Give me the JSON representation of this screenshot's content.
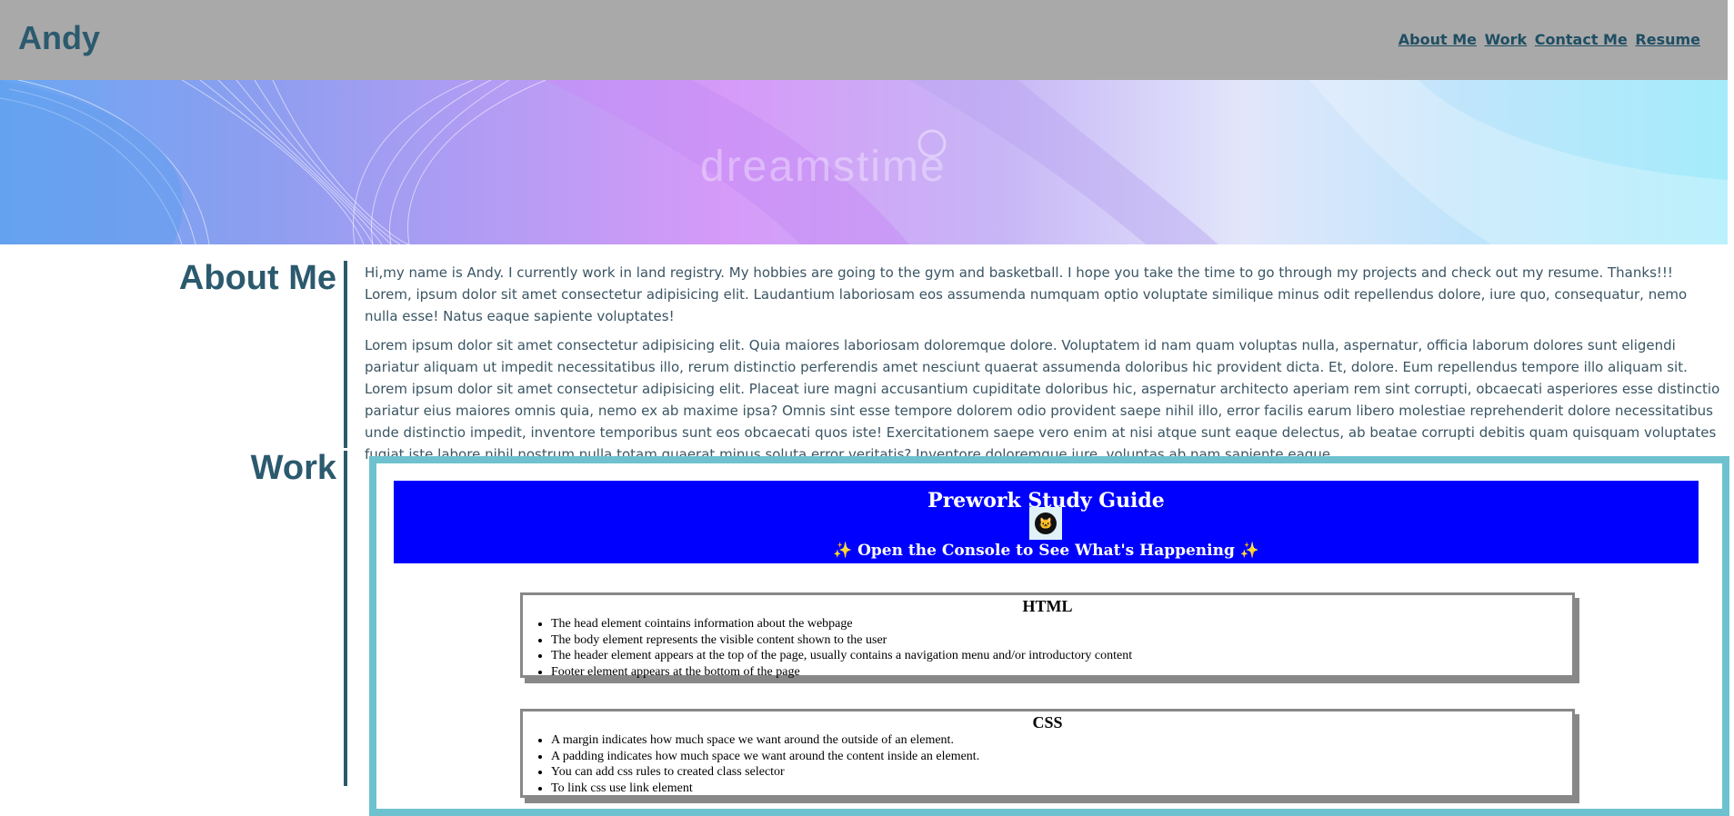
{
  "header": {
    "brand": "Andy",
    "nav": [
      "About Me",
      "Work",
      "Contact Me",
      "Resume"
    ]
  },
  "hero": {
    "watermark": "dreamstime"
  },
  "about": {
    "title": "About Me",
    "paragraphs": [
      "Hi,my name is Andy. I currently work in land registry. My hobbies are going to the gym and basketball. I hope you take the time to go through my projects and check out my resume. Thanks!!! Lorem, ipsum dolor sit amet consectetur adipisicing elit. Laudantium laboriosam eos assumenda numquam optio voluptate similique minus odit repellendus dolore, iure quo, consequatur, nemo nulla esse! Natus eaque sapiente voluptates!",
      "Lorem ipsum dolor sit amet consectetur adipisicing elit. Quia maiores laboriosam doloremque dolore. Voluptatem id nam quam voluptas nulla, aspernatur, officia laborum dolores sunt eligendi pariatur aliquam ut impedit necessitatibus illo, rerum distinctio perferendis amet nesciunt quaerat assumenda doloribus hic provident dicta. Et, dolore. Eum repellendus tempore illo aliquam sit. Lorem ipsum dolor sit amet consectetur adipisicing elit. Placeat iure magni accusantium cupiditate doloribus hic, aspernatur architecto aperiam rem sint corrupti, obcaecati asperiores esse distinctio pariatur eius maiores omnis quia, nemo ex ab maxime ipsa? Omnis sint esse tempore dolorem odio provident saepe nihil illo, error facilis earum libero molestiae reprehenderit dolore necessitatibus unde distinctio impedit, inventore temporibus sunt eos obcaecati quos iste! Exercitationem saepe vero enim at nisi atque sunt eaque delectus, ab beatae corrupti debitis quam quisquam voluptates fugiat iste labore nihil nostrum nulla totam quaerat minus soluta error veritatis? Inventore doloremque iure, voluptas ab nam sapiente eaque."
    ]
  },
  "work": {
    "title": "Work",
    "embed": {
      "title": "Prework Study Guide",
      "subtitle": "✨ Open the Console to See What's Happening ✨",
      "logo_icon": "github-cat-icon",
      "cards": [
        {
          "heading": "HTML",
          "items": [
            "The head element cointains information about the webpage",
            "The body element represents the visible content shown to the user",
            "The header element appears at the top of the page, usually contains a navigation menu and/or introductory content",
            "Footer element appears at the bottom of the page"
          ]
        },
        {
          "heading": "CSS",
          "items": [
            "A margin indicates how much space we want around the outside of an element.",
            "A padding indicates how much space we want around the content inside an element.",
            "You can add css rules to created class selector",
            "To link css use link element"
          ]
        }
      ]
    }
  },
  "colors": {
    "header_bg": "#a9a9a9",
    "accent": "#2b5a6e",
    "frame_border": "#6ec2cf",
    "embed_header_bg": "#0000ff"
  }
}
